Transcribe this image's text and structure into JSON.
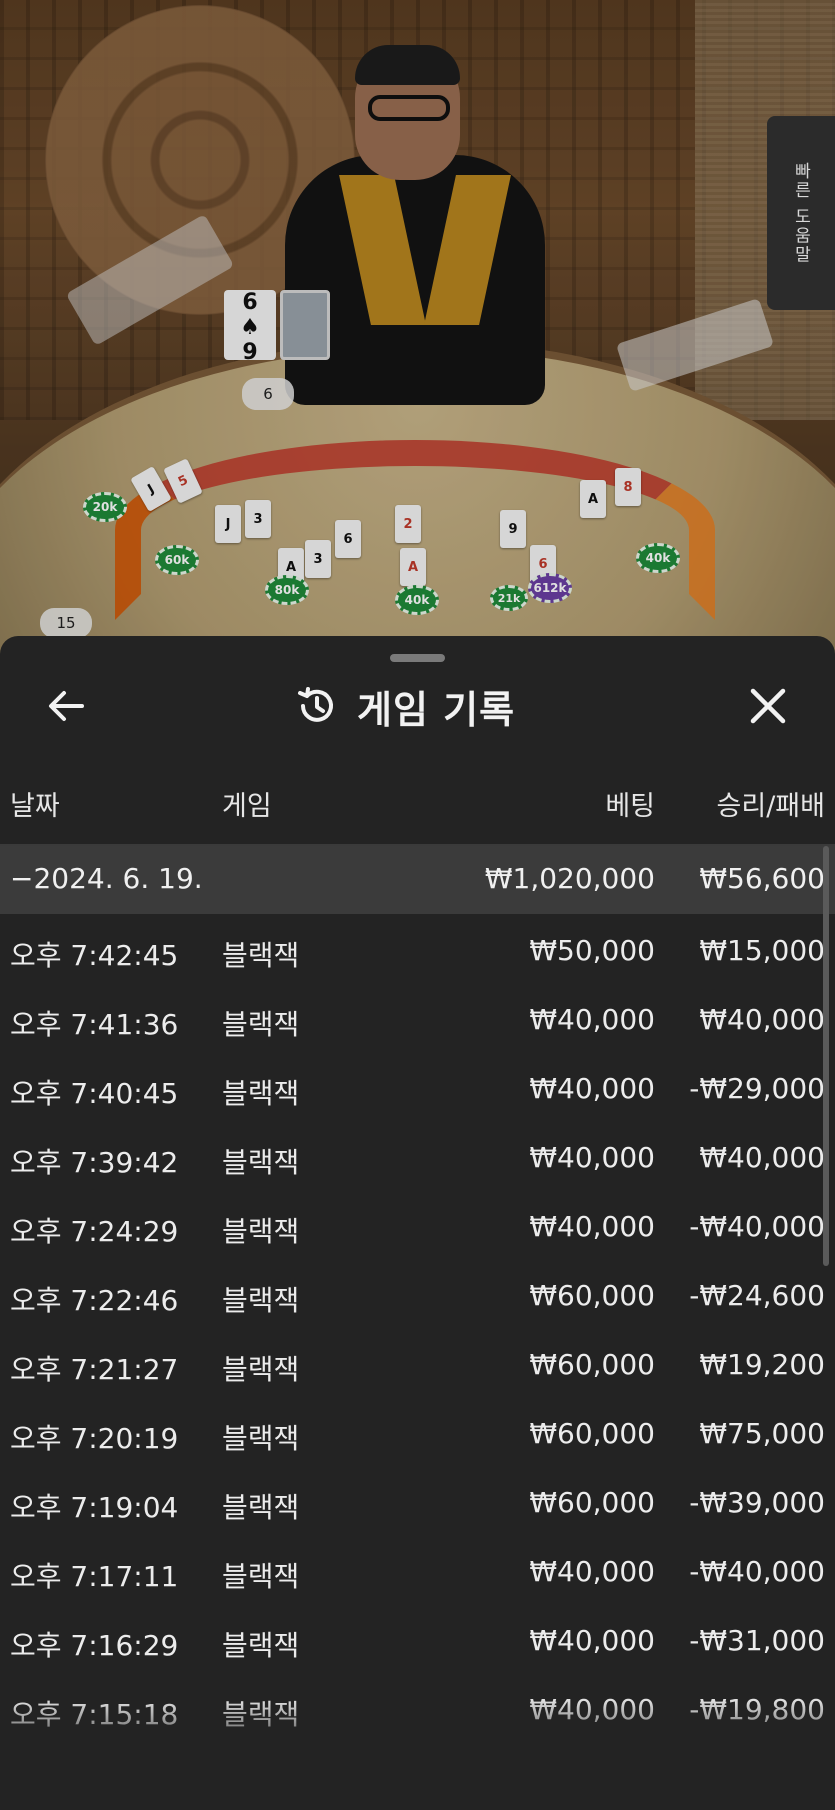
{
  "quick_help": {
    "label": "빠른 도움말"
  },
  "table_scene": {
    "dealer_hand_value": "6",
    "seat_count_badge": "15",
    "dealer_card": {
      "top": "6",
      "bottom": "9",
      "suit": "♠"
    },
    "chips": [
      "20k",
      "60k",
      "80k",
      "40k",
      "21k",
      "612k",
      "40k"
    ]
  },
  "sheet": {
    "title": "게임 기록",
    "back_icon": "arrow-left-icon",
    "history_icon": "history-clock-icon",
    "close_icon": "close-icon"
  },
  "columns": {
    "date": "날짜",
    "game": "게임",
    "bet": "베팅",
    "result": "승리/패배"
  },
  "date_group": {
    "label": "−2024. 6. 19.",
    "bet_total": "₩1,020,000",
    "result_total": "₩56,600"
  },
  "rows": [
    {
      "time": "오후 7:42:45",
      "game": "블랙잭",
      "bet": "₩50,000",
      "result": "₩15,000"
    },
    {
      "time": "오후 7:41:36",
      "game": "블랙잭",
      "bet": "₩40,000",
      "result": "₩40,000"
    },
    {
      "time": "오후 7:40:45",
      "game": "블랙잭",
      "bet": "₩40,000",
      "result": "-₩29,000"
    },
    {
      "time": "오후 7:39:42",
      "game": "블랙잭",
      "bet": "₩40,000",
      "result": "₩40,000"
    },
    {
      "time": "오후 7:24:29",
      "game": "블랙잭",
      "bet": "₩40,000",
      "result": "-₩40,000"
    },
    {
      "time": "오후 7:22:46",
      "game": "블랙잭",
      "bet": "₩60,000",
      "result": "-₩24,600"
    },
    {
      "time": "오후 7:21:27",
      "game": "블랙잭",
      "bet": "₩60,000",
      "result": "₩19,200"
    },
    {
      "time": "오후 7:20:19",
      "game": "블랙잭",
      "bet": "₩60,000",
      "result": "₩75,000"
    },
    {
      "time": "오후 7:19:04",
      "game": "블랙잭",
      "bet": "₩60,000",
      "result": "-₩39,000"
    },
    {
      "time": "오후 7:17:11",
      "game": "블랙잭",
      "bet": "₩40,000",
      "result": "-₩40,000"
    },
    {
      "time": "오후 7:16:29",
      "game": "블랙잭",
      "bet": "₩40,000",
      "result": "-₩31,000"
    },
    {
      "time": "오후 7:15:18",
      "game": "블랙잭",
      "bet": "₩40,000",
      "result": "-₩19,800"
    }
  ]
}
